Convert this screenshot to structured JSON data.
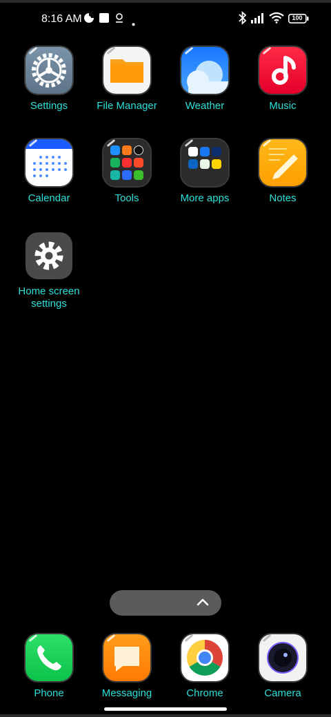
{
  "status_bar": {
    "time": "8:16 AM",
    "battery_level": "100"
  },
  "apps": [
    {
      "label": "Settings",
      "icon": "settings-gear-icon"
    },
    {
      "label": "File Manager",
      "icon": "folder-icon"
    },
    {
      "label": "Weather",
      "icon": "cloud-icon"
    },
    {
      "label": "Music",
      "icon": "music-note-icon"
    },
    {
      "label": "Calendar",
      "icon": "calendar-icon"
    },
    {
      "label": "Tools",
      "icon": "tools-folder-icon"
    },
    {
      "label": "More apps",
      "icon": "more-apps-folder-icon"
    },
    {
      "label": "Notes",
      "icon": "pencil-notes-icon"
    },
    {
      "label": "Home screen settings",
      "icon": "gear-icon"
    }
  ],
  "dock": [
    {
      "label": "Phone",
      "icon": "phone-icon"
    },
    {
      "label": "Messaging",
      "icon": "message-icon"
    },
    {
      "label": "Chrome",
      "icon": "chrome-icon"
    },
    {
      "label": "Camera",
      "icon": "camera-icon"
    }
  ],
  "colors": {
    "label": "#2be0d8",
    "background": "#000000"
  }
}
